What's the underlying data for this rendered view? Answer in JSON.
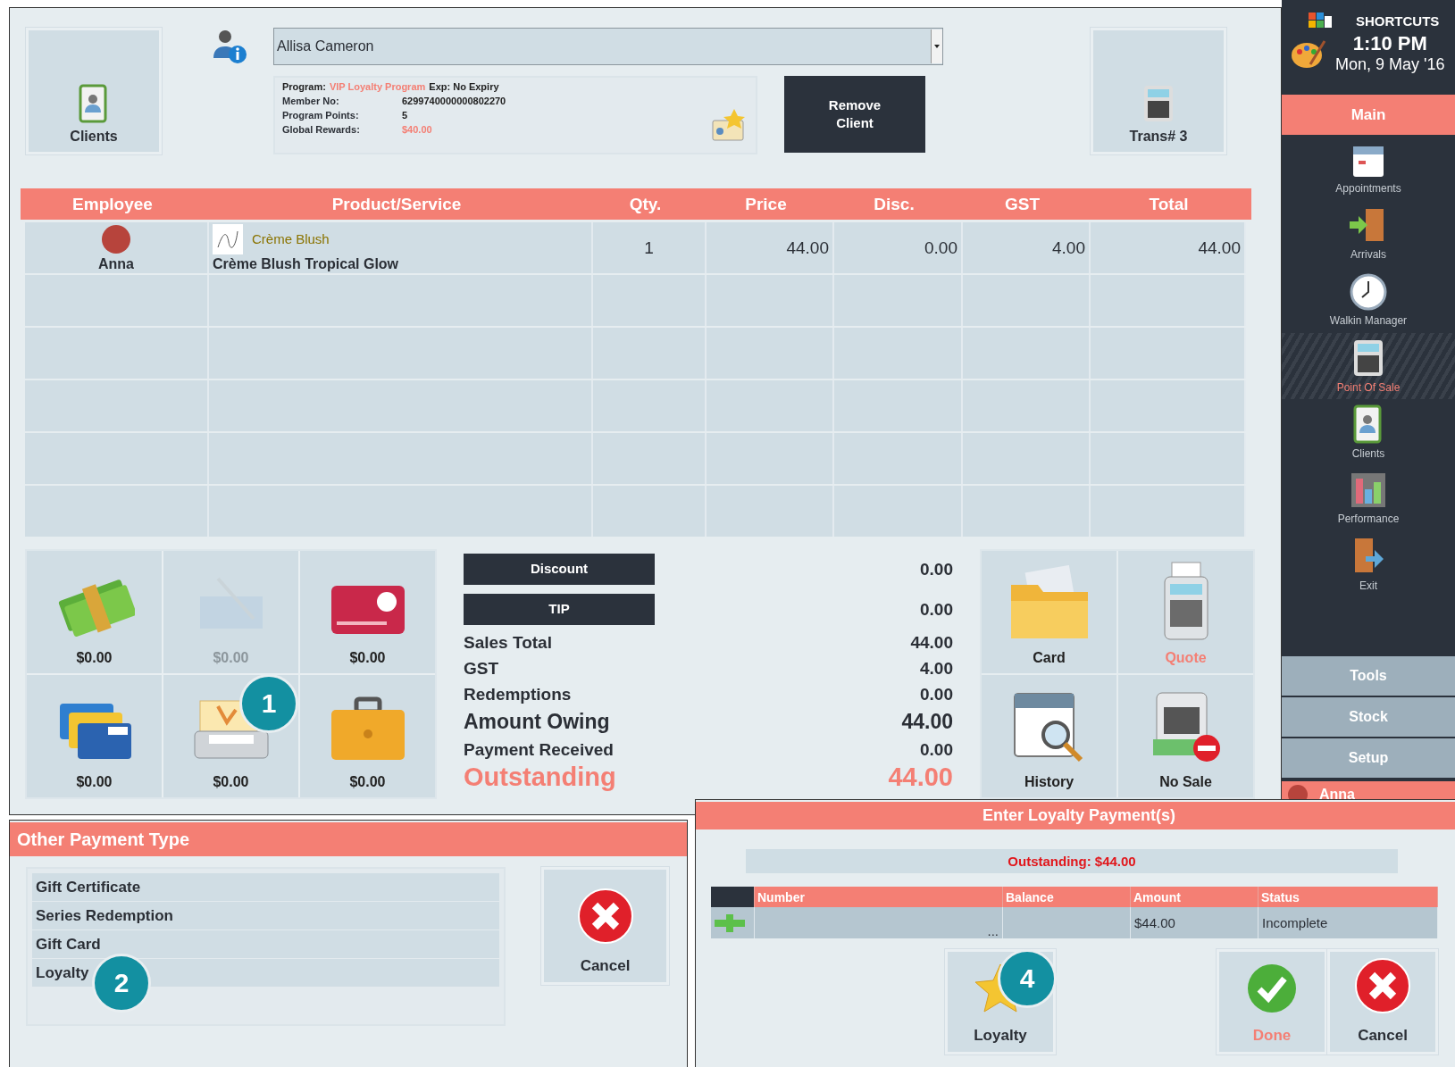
{
  "header": {
    "clients_button": "Clients",
    "client_select": "Allisa Cameron",
    "loyalty_info": {
      "program_label": "Program:",
      "program": "VIP Loyalty Program",
      "expiry": "Exp: No Expiry",
      "rows": [
        {
          "label": "Member No:",
          "value": "6299740000000802270",
          "kind": "plain"
        },
        {
          "label": "Program Points:",
          "value": "5",
          "kind": "plain"
        },
        {
          "label": "Global Rewards:",
          "value": "$40.00",
          "kind": "accent"
        }
      ]
    },
    "remove_button": "Remove Client",
    "trans_button": "Trans# 3"
  },
  "table": {
    "columns": [
      "Employee",
      "Product/Service",
      "Qty.",
      "Price",
      "Disc.",
      "GST",
      "Total"
    ],
    "rows": [
      {
        "employee": "Anna",
        "category": "Crème Blush",
        "product": "Crème Blush Tropical Glow",
        "qty": "1",
        "price": "44.00",
        "disc": "0.00",
        "gst": "4.00",
        "total": "44.00"
      }
    ]
  },
  "tenders": [
    {
      "kind": "cash",
      "amount": "$0.00",
      "disabled": false
    },
    {
      "kind": "cheque",
      "amount": "$0.00",
      "disabled": true
    },
    {
      "kind": "eftpos",
      "amount": "$0.00",
      "disabled": false
    },
    {
      "kind": "credit",
      "amount": "$0.00",
      "disabled": false
    },
    {
      "kind": "gift",
      "amount": "$0.00",
      "disabled": false,
      "callout": "1"
    },
    {
      "kind": "account",
      "amount": "$0.00",
      "disabled": false
    }
  ],
  "summary": {
    "buttons": [
      {
        "label": "Discount",
        "value": "0.00"
      },
      {
        "label": "TIP",
        "value": "0.00"
      }
    ],
    "lines": [
      {
        "label": "Sales Total",
        "value": "44.00",
        "kind": "normal"
      },
      {
        "label": "GST",
        "value": "4.00",
        "kind": "normal"
      },
      {
        "label": "Redemptions",
        "value": "0.00",
        "kind": "normal"
      },
      {
        "label": "Amount Owing",
        "value": "44.00",
        "kind": "emphasis"
      },
      {
        "label": "Payment Received",
        "value": "0.00",
        "kind": "normal"
      },
      {
        "label": "Outstanding",
        "value": "44.00",
        "kind": "outstanding"
      }
    ]
  },
  "actions": [
    {
      "label": "Card",
      "kind": "card",
      "highlighted": false
    },
    {
      "label": "Quote",
      "kind": "quote",
      "highlighted": true
    },
    {
      "label": "History",
      "kind": "history",
      "highlighted": false
    },
    {
      "label": "No Sale",
      "kind": "nosale",
      "highlighted": false
    }
  ],
  "sidebar": {
    "title": "SHORTCUTS",
    "time": "1:10 PM",
    "date": "Mon, 9 May '16",
    "main_tab": "Main",
    "items": [
      {
        "label": "Appointments",
        "kind": "appointments",
        "selected": false
      },
      {
        "label": "Arrivals",
        "kind": "arrivals",
        "selected": false
      },
      {
        "label": "Walkin Manager",
        "kind": "walkin",
        "selected": false
      },
      {
        "label": "Point Of Sale",
        "kind": "pos",
        "selected": true
      },
      {
        "label": "Clients",
        "kind": "clients",
        "selected": false
      },
      {
        "label": "Performance",
        "kind": "performance",
        "selected": false
      },
      {
        "label": "Exit",
        "kind": "exit",
        "selected": false
      }
    ],
    "sections": [
      "Tools",
      "Stock",
      "Setup"
    ],
    "user": "Anna"
  },
  "other_payment": {
    "title": "Other Payment Type",
    "options": [
      {
        "label": "Gift Certificate",
        "selected": false
      },
      {
        "label": "Series Redemption",
        "selected": false
      },
      {
        "label": "Gift Card",
        "selected": false
      },
      {
        "label": "Loyalty",
        "selected": false,
        "callout": "2"
      }
    ],
    "cancel": "Cancel"
  },
  "loyalty_payment": {
    "title": "Enter Loyalty Payment(s)",
    "outstanding": "Outstanding: $44.00",
    "columns": [
      "Number",
      "Balance",
      "Amount",
      "Status"
    ],
    "rows": [
      {
        "number": "...",
        "balance": "",
        "amount": "$44.00",
        "status": "Incomplete"
      }
    ],
    "buttons": [
      {
        "label": "Loyalty",
        "kind": "loyalty",
        "highlighted": false,
        "callout": "4"
      },
      {
        "label": "Done",
        "kind": "done",
        "highlighted": true
      },
      {
        "label": "Cancel",
        "kind": "cancel",
        "highlighted": false
      }
    ]
  }
}
